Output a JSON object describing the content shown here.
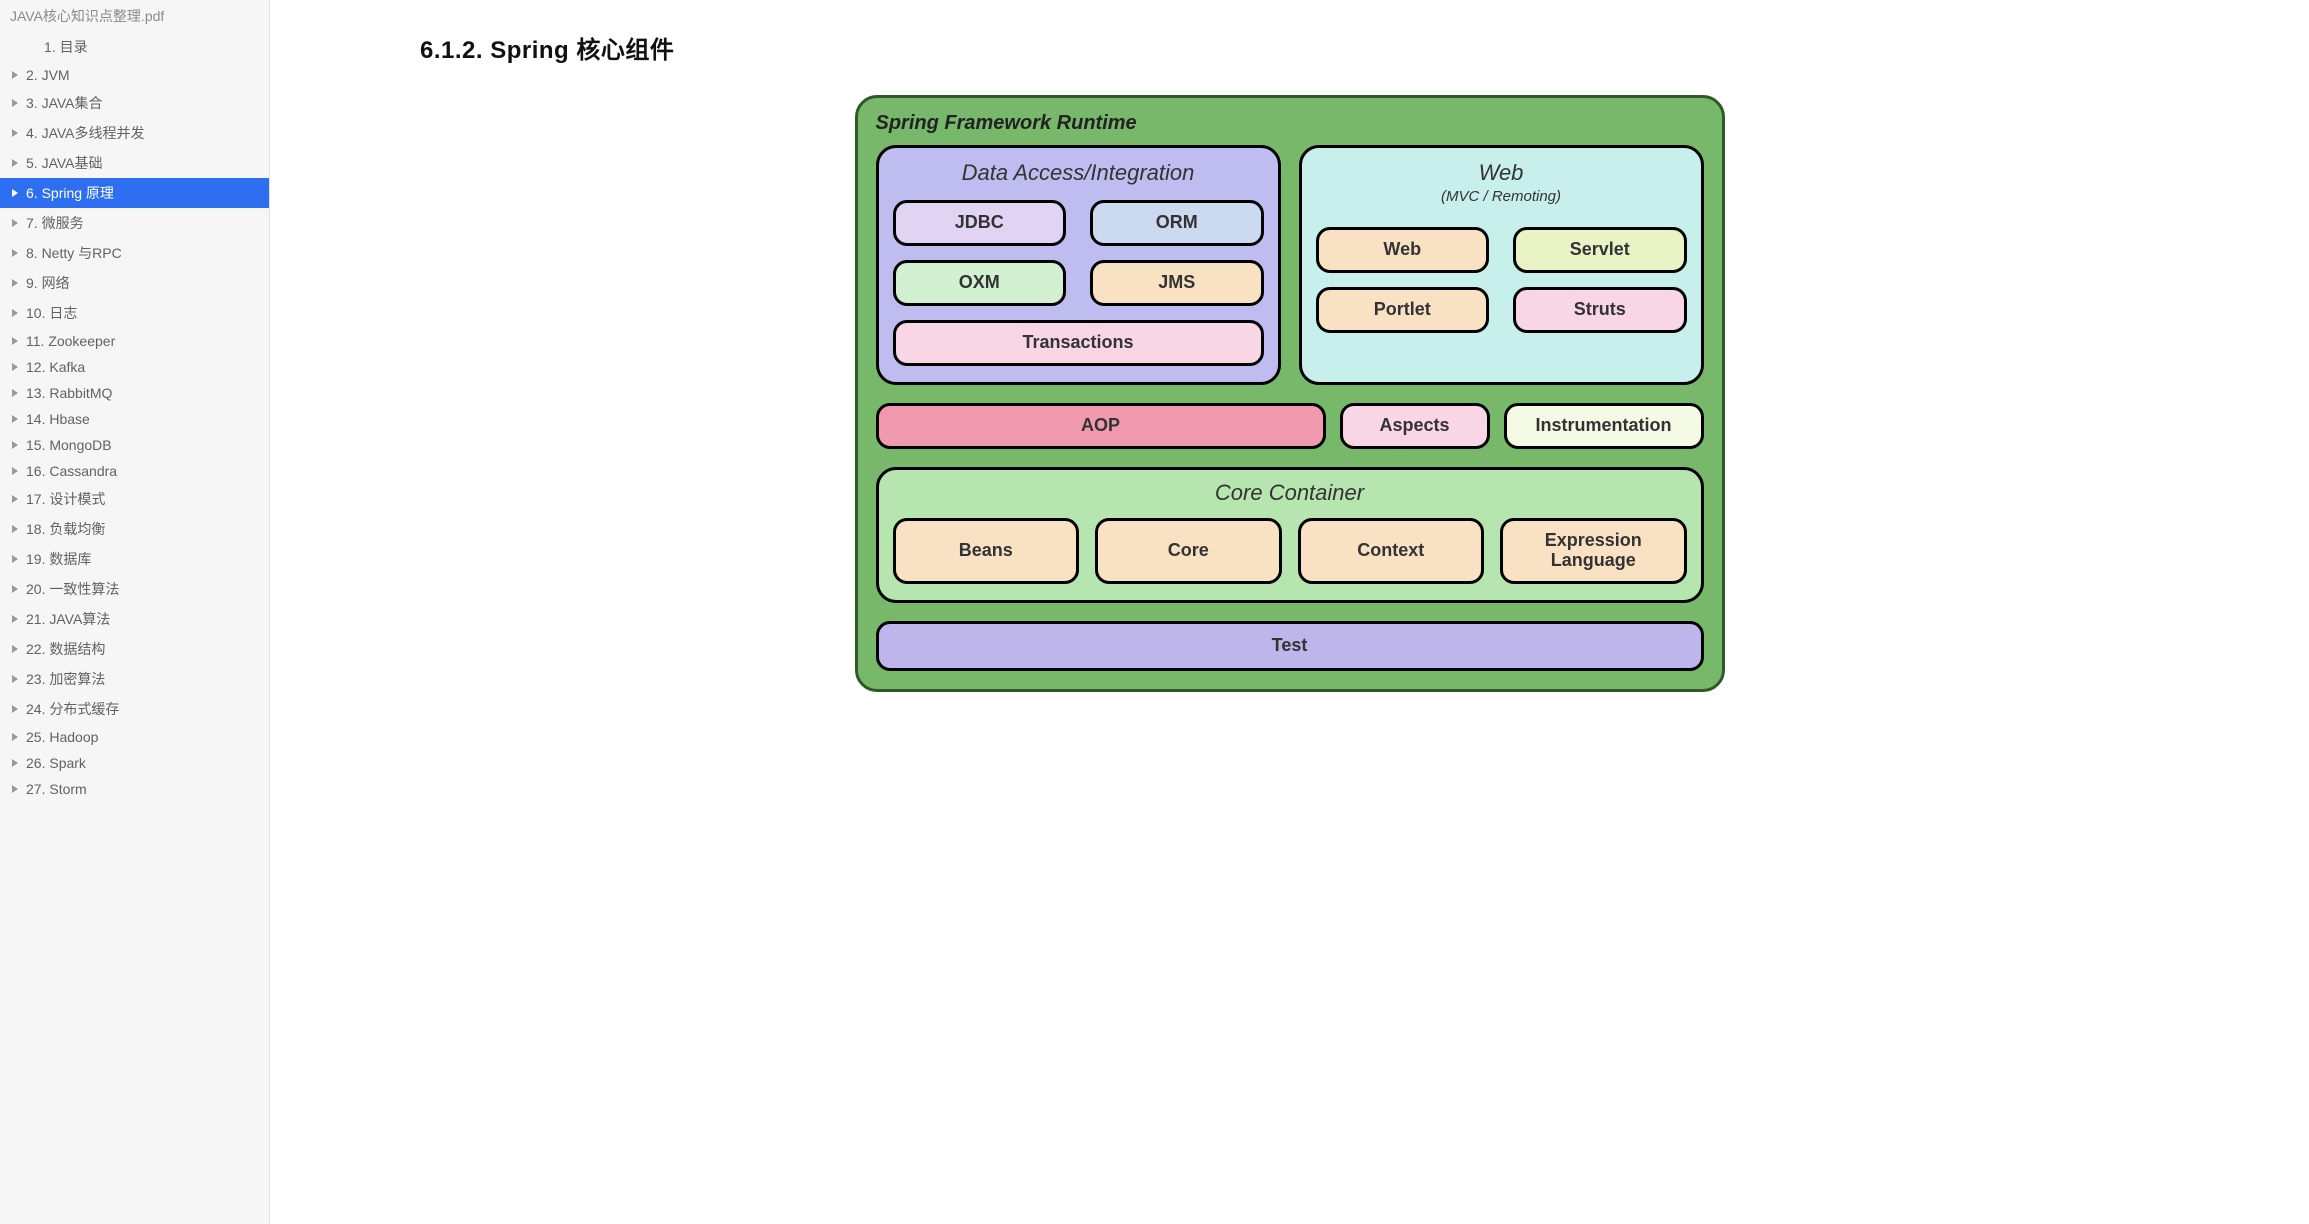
{
  "sidebar": {
    "docTitle": "JAVA核心知识点整理.pdf",
    "items": [
      {
        "label": "1. 目录",
        "indent": true,
        "tri": false,
        "active": false
      },
      {
        "label": "2. JVM",
        "indent": false,
        "tri": true,
        "active": false
      },
      {
        "label": "3. JAVA集合",
        "indent": false,
        "tri": true,
        "active": false
      },
      {
        "label": "4. JAVA多线程并发",
        "indent": false,
        "tri": true,
        "active": false
      },
      {
        "label": "5. JAVA基础",
        "indent": false,
        "tri": true,
        "active": false
      },
      {
        "label": "6. Spring 原理",
        "indent": false,
        "tri": true,
        "active": true
      },
      {
        "label": "7.   微服务",
        "indent": false,
        "tri": true,
        "active": false
      },
      {
        "label": "8. Netty 与RPC",
        "indent": false,
        "tri": true,
        "active": false
      },
      {
        "label": "9. 网络",
        "indent": false,
        "tri": true,
        "active": false
      },
      {
        "label": "10. 日志",
        "indent": false,
        "tri": true,
        "active": false
      },
      {
        "label": "11. Zookeeper",
        "indent": false,
        "tri": true,
        "active": false
      },
      {
        "label": "12. Kafka",
        "indent": false,
        "tri": true,
        "active": false
      },
      {
        "label": "13. RabbitMQ",
        "indent": false,
        "tri": true,
        "active": false
      },
      {
        "label": "14. Hbase",
        "indent": false,
        "tri": true,
        "active": false
      },
      {
        "label": "15. MongoDB",
        "indent": false,
        "tri": true,
        "active": false
      },
      {
        "label": "16. Cassandra",
        "indent": false,
        "tri": true,
        "active": false
      },
      {
        "label": "17. 设计模式",
        "indent": false,
        "tri": true,
        "active": false
      },
      {
        "label": "18. 负载均衡",
        "indent": false,
        "tri": true,
        "active": false
      },
      {
        "label": "19. 数据库",
        "indent": false,
        "tri": true,
        "active": false
      },
      {
        "label": "20. 一致性算法",
        "indent": false,
        "tri": true,
        "active": false
      },
      {
        "label": "21. JAVA算法",
        "indent": false,
        "tri": true,
        "active": false
      },
      {
        "label": "22. 数据结构",
        "indent": false,
        "tri": true,
        "active": false
      },
      {
        "label": "23. 加密算法",
        "indent": false,
        "tri": true,
        "active": false
      },
      {
        "label": "24. 分布式缓存",
        "indent": false,
        "tri": true,
        "active": false
      },
      {
        "label": "25. Hadoop",
        "indent": false,
        "tri": true,
        "active": false
      },
      {
        "label": "26. Spark",
        "indent": false,
        "tri": true,
        "active": false
      },
      {
        "label": "27. Storm",
        "indent": false,
        "tri": true,
        "active": false
      }
    ]
  },
  "page": {
    "heading": "6.1.2.  Spring 核心组件"
  },
  "diagram": {
    "runtimeTitle": "Spring Framework Runtime",
    "dataAccess": {
      "title": "Data Access/Integration",
      "chips": [
        {
          "label": "JDBC",
          "color": "c-lilac"
        },
        {
          "label": "ORM",
          "color": "c-blue"
        },
        {
          "label": "OXM",
          "color": "c-mint"
        },
        {
          "label": "JMS",
          "color": "c-peach"
        },
        {
          "label": "Transactions",
          "color": "c-pink",
          "wide": true
        }
      ]
    },
    "web": {
      "title": "Web",
      "subtitle": "(MVC / Remoting)",
      "chips": [
        {
          "label": "Web",
          "color": "c-peach"
        },
        {
          "label": "Servlet",
          "color": "c-ygrn"
        },
        {
          "label": "Portlet",
          "color": "c-peach"
        },
        {
          "label": "Struts",
          "color": "c-pink"
        }
      ]
    },
    "mid": {
      "aop": "AOP",
      "aspects": "Aspects",
      "instrumentation": "Instrumentation"
    },
    "core": {
      "title": "Core Container",
      "chips": [
        {
          "label": "Beans",
          "color": "c-peach"
        },
        {
          "label": "Core",
          "color": "c-peach"
        },
        {
          "label": "Context",
          "color": "c-peach"
        },
        {
          "label": "Expression Language",
          "color": "c-peach"
        }
      ]
    },
    "test": "Test"
  }
}
